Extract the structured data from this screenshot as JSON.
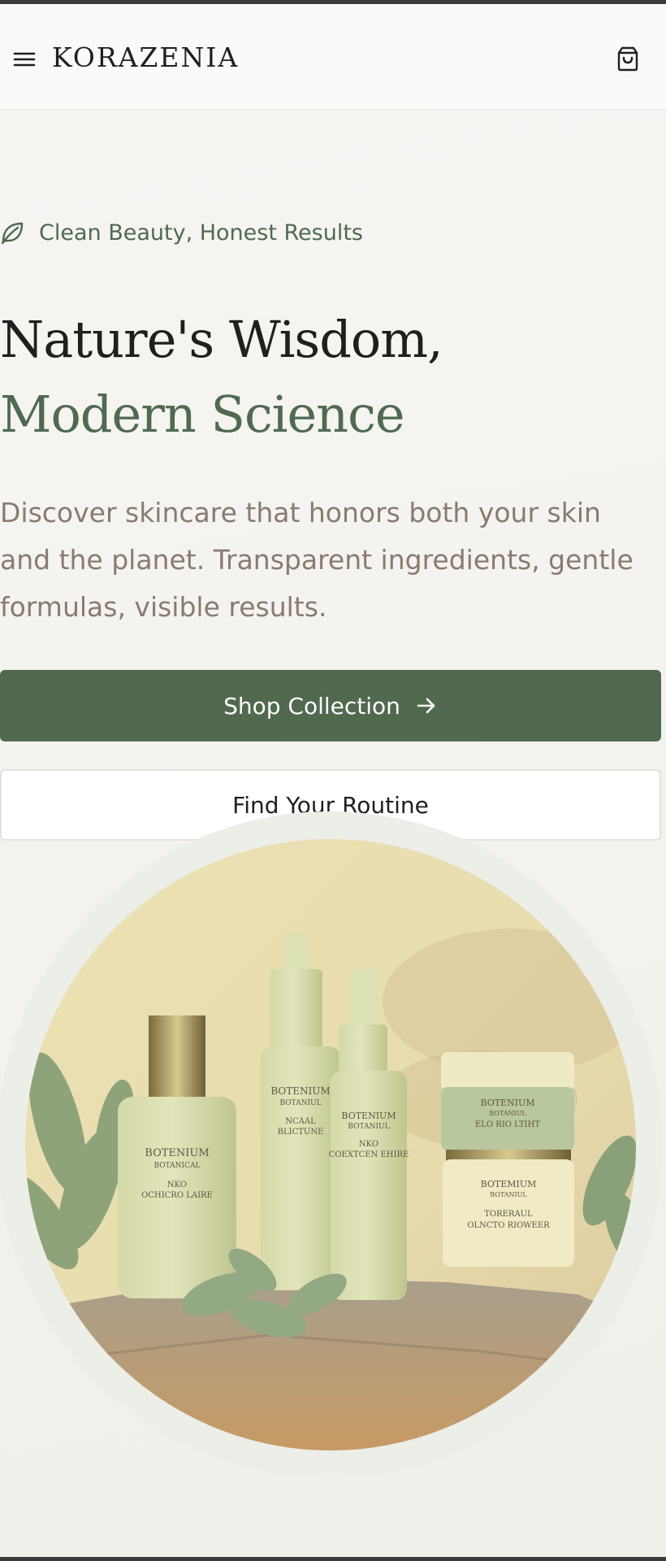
{
  "header": {
    "brand": "KORAZENIA",
    "menu_icon": "hamburger-menu-icon",
    "cart_icon": "shopping-bag-icon"
  },
  "hero": {
    "tagline_icon": "leaf-icon",
    "tagline": "Clean Beauty, Honest Results",
    "headline_line1": "Nature's Wisdom,",
    "headline_line2": "Modern Science",
    "description": "Discover skincare that honors both your skin and the planet. Transparent ingredients, gentle formulas, visible results.",
    "primary_button": "Shop Collection",
    "primary_button_icon": "arrow-right-icon",
    "secondary_button": "Find Your Routine"
  },
  "products": {
    "bottle1": {
      "brand": "BOTENIUM",
      "sub": "BOTANICAL",
      "line1": "NKO",
      "line2": "OCHICRO LAIRE"
    },
    "bottle2": {
      "brand": "BOTENIUM",
      "sub": "BOTANIUL",
      "line1": "NCAAL",
      "line2": "BLICTUNE"
    },
    "bottle3": {
      "brand": "BOTENIUM",
      "sub": "BOTANIUL",
      "line1": "NKO",
      "line2": "COEXTCEN EHIRE"
    },
    "jar_top": {
      "brand": "BOTENIUM",
      "sub": "BOTANIUL",
      "line1": "ELO RIO LTIHT"
    },
    "jar_bottom": {
      "brand": "BOTEMIUM",
      "sub": "BOTANIUL",
      "line1": "TORERAUL",
      "line2": "OLNCTO RIOWEER"
    }
  },
  "colors": {
    "accent_green": "#51694f",
    "tagline_green": "#4f6a51",
    "description_text": "#8a7a72",
    "headline_text": "#1f1f1d"
  }
}
